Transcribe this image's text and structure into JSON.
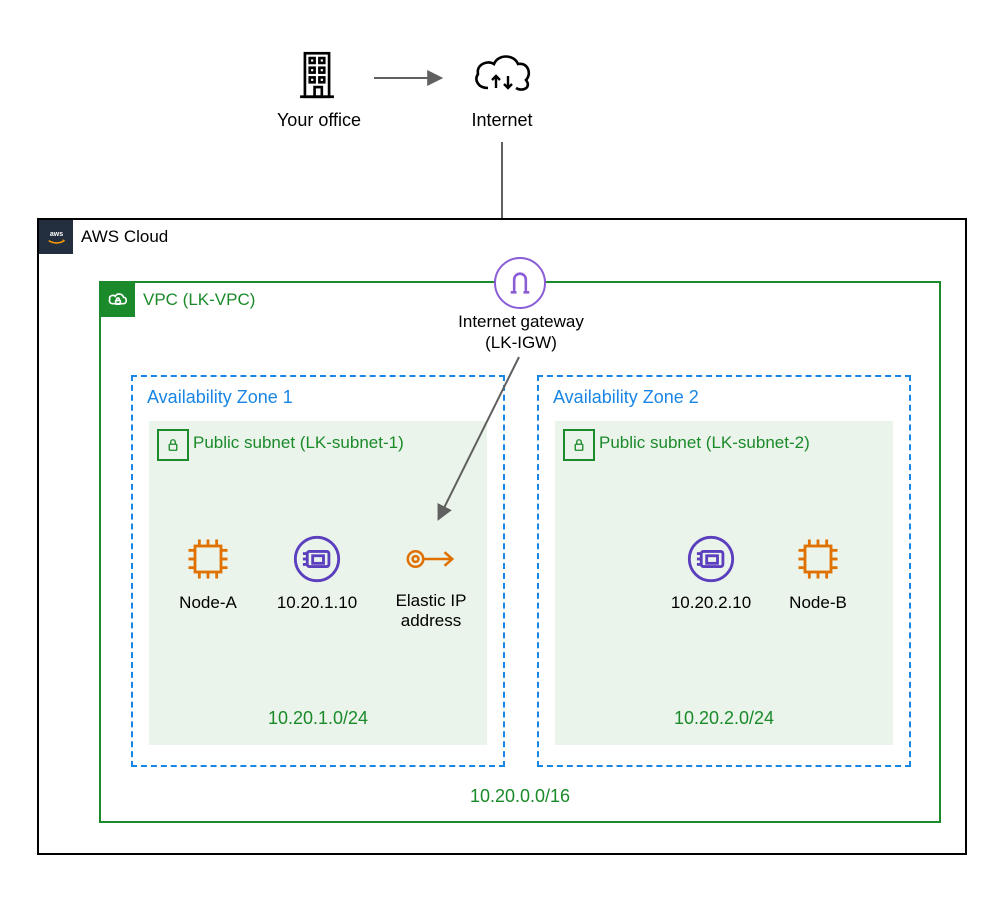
{
  "external": {
    "office_label": "Your office",
    "internet_label": "Internet"
  },
  "aws": {
    "title": "AWS Cloud"
  },
  "vpc": {
    "title": "VPC (LK-VPC)",
    "cidr": "10.20.0.0/16"
  },
  "igw": {
    "label_line1": "Internet gateway",
    "label_line2": "(LK-IGW)"
  },
  "az": {
    "1": {
      "title": "Availability Zone 1"
    },
    "2": {
      "title": "Availability Zone 2"
    }
  },
  "subnets": {
    "1": {
      "title": "Public subnet (LK-subnet-1)",
      "cidr": "10.20.1.0/24",
      "resources": {
        "node": "Node-A",
        "eni_ip": "10.20.1.10",
        "eip": "Elastic IP\naddress"
      }
    },
    "2": {
      "title": "Public subnet (LK-subnet-2)",
      "cidr": "10.20.2.0/24",
      "resources": {
        "node": "Node-B",
        "eni_ip": "10.20.2.10"
      }
    }
  }
}
